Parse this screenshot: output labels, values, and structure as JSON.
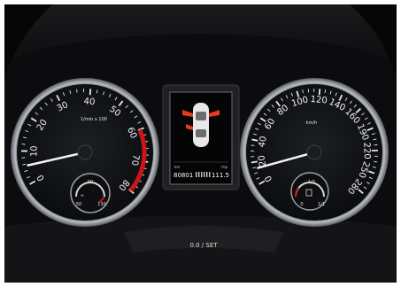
{
  "tachometer": {
    "ticks": [
      "0",
      "10",
      "20",
      "30",
      "40",
      "50",
      "60",
      "70",
      "80"
    ],
    "unit": "1/min x 100",
    "needle_value": 5.5,
    "temp_gauge": {
      "top": "90",
      "left": "50",
      "right": "130"
    }
  },
  "speedometer": {
    "ticks": [
      "0",
      "20",
      "40",
      "60",
      "80",
      "100",
      "120",
      "140",
      "160",
      "190",
      "220",
      "250",
      "280"
    ],
    "unit": "km/h",
    "needle_value": 0,
    "fuel_gauge": {
      "left": "0",
      "top": "1/2",
      "right": "1/1"
    }
  },
  "display": {
    "odometer": "80801",
    "odometer_unit": "km",
    "trip": "111.5",
    "trip_unit": "trip"
  },
  "reset_button": {
    "label": "0.0 / SET"
  },
  "colors": {
    "redline": "#c8141a",
    "door_warning": "#e63a1e",
    "needle": "#f4f4f4",
    "dial_face": "#131518",
    "dashboard": "#0c0c0e"
  }
}
